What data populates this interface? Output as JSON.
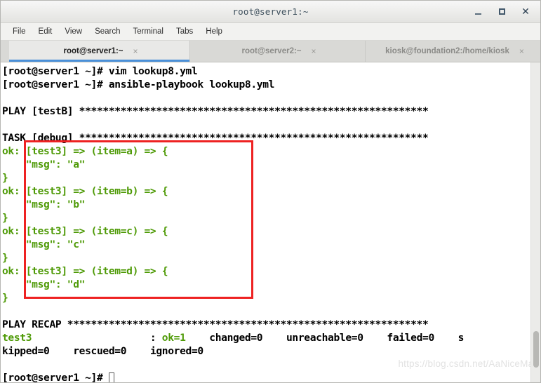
{
  "window": {
    "title": "root@server1:~",
    "controls": [
      {
        "name": "minimize",
        "label": "–"
      },
      {
        "name": "maximize",
        "label": "□"
      },
      {
        "name": "close",
        "label": "✕"
      }
    ]
  },
  "menubar": {
    "items": [
      "File",
      "Edit",
      "View",
      "Search",
      "Terminal",
      "Tabs",
      "Help"
    ]
  },
  "tabs": [
    {
      "label": "root@server1:~",
      "close": "×",
      "active": true
    },
    {
      "label": "root@server2:~",
      "close": "×",
      "active": false
    },
    {
      "label": "kiosk@foundation2:/home/kiosk",
      "close": "×",
      "active": false
    }
  ],
  "terminal": {
    "prompt": "[root@server1 ~]#",
    "lines": [
      {
        "text": "[root@server1 ~]# vim lookup8.yml",
        "color": "black"
      },
      {
        "text": "[root@server1 ~]# ansible-playbook lookup8.yml",
        "color": "black"
      },
      {
        "text": "",
        "color": "black"
      },
      {
        "text": "PLAY [testB] ***********************************************************",
        "color": "black"
      },
      {
        "text": "",
        "color": "black"
      },
      {
        "text": "TASK [debug] ***********************************************************",
        "color": "black"
      },
      {
        "text": "ok: [test3] => (item=a) => {",
        "color": "green"
      },
      {
        "text": "    \"msg\": \"a\"",
        "color": "green"
      },
      {
        "text": "}",
        "color": "green"
      },
      {
        "text": "ok: [test3] => (item=b) => {",
        "color": "green"
      },
      {
        "text": "    \"msg\": \"b\"",
        "color": "green"
      },
      {
        "text": "}",
        "color": "green"
      },
      {
        "text": "ok: [test3] => (item=c) => {",
        "color": "green"
      },
      {
        "text": "    \"msg\": \"c\"",
        "color": "green"
      },
      {
        "text": "}",
        "color": "green"
      },
      {
        "text": "ok: [test3] => (item=d) => {",
        "color": "green"
      },
      {
        "text": "    \"msg\": \"d\"",
        "color": "green"
      },
      {
        "text": "}",
        "color": "green"
      },
      {
        "text": "",
        "color": "black"
      },
      {
        "text": "PLAY RECAP *************************************************************",
        "color": "black"
      }
    ],
    "recap": {
      "host": "test3",
      "separator": ":",
      "ok": "ok=1",
      "changed": "changed=0",
      "unreachable": "unreachable=0",
      "failed": "failed=0",
      "skipped_head": "s",
      "skipped_tail": "kipped=0",
      "rescued": "rescued=0",
      "ignored": "ignored=0"
    },
    "final_prompt": "[root@server1 ~]# "
  },
  "annotation": {
    "shape": "rectangle",
    "color": "#ee2222"
  },
  "watermark": {
    "text": "https://blog.csdn.net/AaNiceMan"
  },
  "colors": {
    "terminal_background": "#ffffff",
    "terminal_foreground": "#000000",
    "ansible_ok_green": "#4e9a06",
    "tab_accent": "#4a90d9",
    "annotation_red": "#ee2222"
  }
}
